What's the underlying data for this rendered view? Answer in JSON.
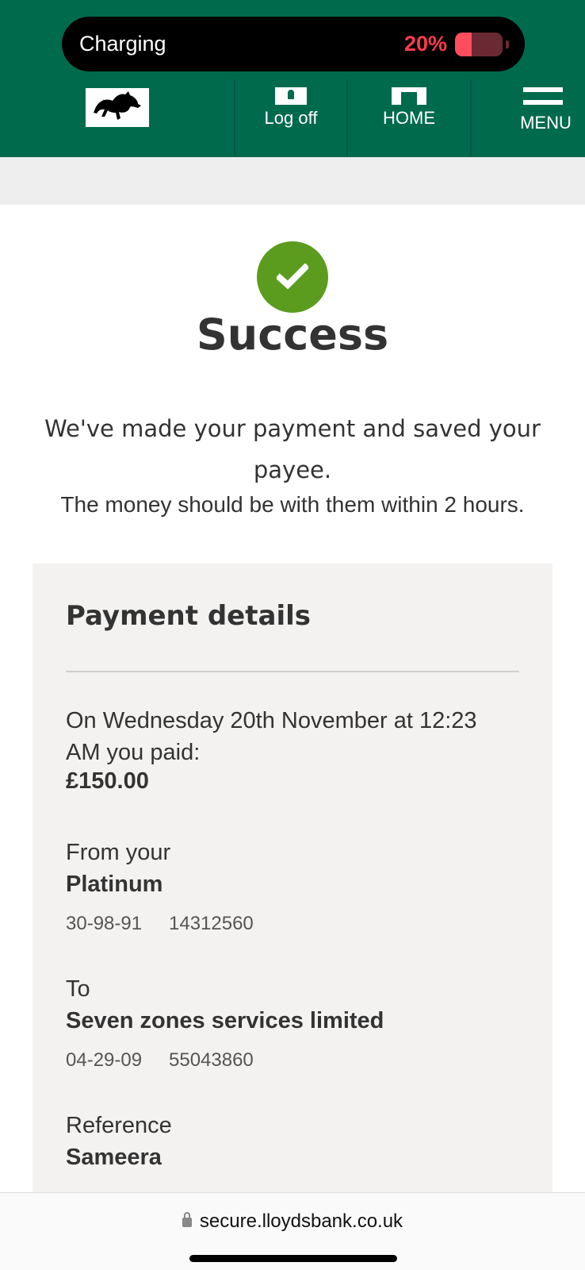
{
  "status_bar": {
    "label": "Charging",
    "battery_percent_text": "20%",
    "battery_level": 0.2,
    "battery_color": "#ff3b4e"
  },
  "nav": {
    "logo_icon": "black-horse-logo",
    "logoff_label": "Log off",
    "logoff_icon": "lock-icon",
    "home_label": "HOME",
    "home_icon": "home-icon",
    "menu_label": "MENU",
    "menu_icon": "hamburger-icon",
    "brand_color": "#006a4d"
  },
  "success": {
    "icon": "checkmark-icon",
    "icon_color": "#5b9c1f",
    "title": "Success",
    "message": "We've made your payment and saved your payee.",
    "sub_message": "The money should be with them within 2 hours."
  },
  "payment_details": {
    "title": "Payment details",
    "date_text": "On Wednesday 20th November at 12:23 AM you paid:",
    "amount": "£150.00",
    "from_label": "From your",
    "from_account": "Platinum",
    "from_sort_code": "30-98-91",
    "from_account_number": "14312560",
    "to_label": "To",
    "to_name": "Seven zones services limited",
    "to_sort_code": "04-29-09",
    "to_account_number": "55043860",
    "reference_label": "Reference",
    "reference_value": "Sameera"
  },
  "browser": {
    "url": "secure.lloydsbank.co.uk"
  }
}
